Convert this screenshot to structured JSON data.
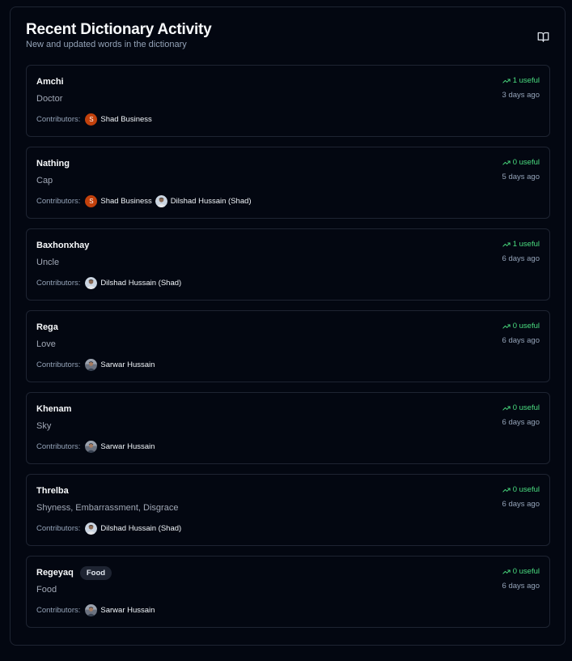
{
  "header": {
    "title": "Recent Dictionary Activity",
    "subtitle": "New and updated words in the dictionary",
    "icon": "book-open-icon"
  },
  "labels": {
    "contributors": "Contributors:"
  },
  "colors": {
    "background": "#030711",
    "border": "#1e2432",
    "useful": "#4ade80",
    "initial_avatar": "#c2410c"
  },
  "entries": [
    {
      "word": "Amchi",
      "tag": "",
      "meaning": "Doctor",
      "useful": "1 useful",
      "time": "3 days ago",
      "contributors": [
        {
          "name": "Shad Business",
          "avatar": "initial",
          "initial": "S"
        }
      ]
    },
    {
      "word": "Nathing",
      "tag": "",
      "meaning": "Cap",
      "useful": "0 useful",
      "time": "5 days ago",
      "contributors": [
        {
          "name": "Shad Business",
          "avatar": "initial",
          "initial": "S"
        },
        {
          "name": "Dilshad Hussain (Shad)",
          "avatar": "photo-a",
          "initial": ""
        }
      ]
    },
    {
      "word": "Baxhonxhay",
      "tag": "",
      "meaning": "Uncle",
      "useful": "1 useful",
      "time": "6 days ago",
      "contributors": [
        {
          "name": "Dilshad Hussain (Shad)",
          "avatar": "photo-a",
          "initial": ""
        }
      ]
    },
    {
      "word": "Rega",
      "tag": "",
      "meaning": "Love",
      "useful": "0 useful",
      "time": "6 days ago",
      "contributors": [
        {
          "name": "Sarwar Hussain",
          "avatar": "photo-b",
          "initial": ""
        }
      ]
    },
    {
      "word": "Khenam",
      "tag": "",
      "meaning": "Sky",
      "useful": "0 useful",
      "time": "6 days ago",
      "contributors": [
        {
          "name": "Sarwar Hussain",
          "avatar": "photo-b",
          "initial": ""
        }
      ]
    },
    {
      "word": "Threlba",
      "tag": "",
      "meaning": "Shyness, Embarrassment, Disgrace",
      "useful": "0 useful",
      "time": "6 days ago",
      "contributors": [
        {
          "name": "Dilshad Hussain (Shad)",
          "avatar": "photo-a",
          "initial": ""
        }
      ]
    },
    {
      "word": "Regeyaq",
      "tag": "Food",
      "meaning": "Food",
      "useful": "0 useful",
      "time": "6 days ago",
      "contributors": [
        {
          "name": "Sarwar Hussain",
          "avatar": "photo-b",
          "initial": ""
        }
      ]
    }
  ]
}
